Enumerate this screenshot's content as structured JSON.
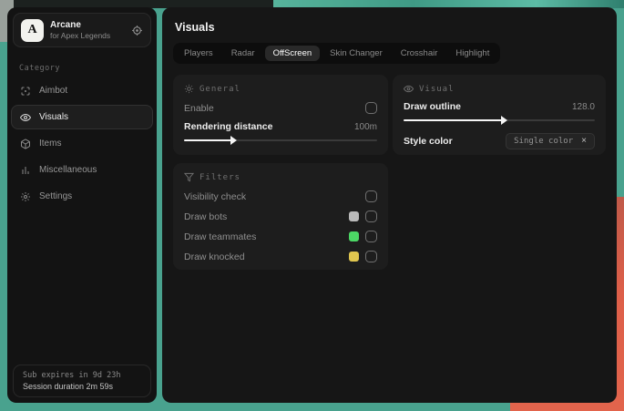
{
  "colors": {
    "backdrop_teal": "#49a28e",
    "backdrop_orange": "#dd5f49",
    "swatch_bots": "#bababa",
    "swatch_teammates": "#4cd765",
    "swatch_knocked": "#e0c64f"
  },
  "sidebar": {
    "app": {
      "initial": "A",
      "title": "Arcane",
      "subtitle": "for Apex Legends"
    },
    "category_label": "Category",
    "items": [
      {
        "label": "Aimbot",
        "icon": "crosshair-icon",
        "selected": false
      },
      {
        "label": "Visuals",
        "icon": "eye-icon",
        "selected": true
      },
      {
        "label": "Items",
        "icon": "box-icon",
        "selected": false
      },
      {
        "label": "Miscellaneous",
        "icon": "bars-icon",
        "selected": false
      },
      {
        "label": "Settings",
        "icon": "gear-icon",
        "selected": false
      }
    ],
    "status": {
      "line1": "Sub expires in 9d 23h",
      "line2": "Session duration 2m 59s"
    }
  },
  "main": {
    "title": "Visuals",
    "tabs": [
      {
        "label": "Players",
        "selected": false
      },
      {
        "label": "Radar",
        "selected": false
      },
      {
        "label": "OffScreen",
        "selected": true
      },
      {
        "label": "Skin Changer",
        "selected": false
      },
      {
        "label": "Crosshair",
        "selected": false
      },
      {
        "label": "Highlight",
        "selected": false
      }
    ],
    "general": {
      "header": "General",
      "enable_label": "Enable",
      "enable_checked": false,
      "rendering_label": "Rendering distance",
      "rendering_value": "100m",
      "slider_fill": "25%"
    },
    "filters": {
      "header": "Filters",
      "rows": [
        {
          "label": "Visibility check",
          "checked": false
        },
        {
          "label": "Draw bots",
          "swatch": "#bababa",
          "checked": false
        },
        {
          "label": "Draw teammates",
          "swatch": "#4cd765",
          "checked": false
        },
        {
          "label": "Draw knocked",
          "swatch": "#e0c64f",
          "checked": false
        }
      ]
    },
    "visual": {
      "header": "Visual",
      "outline_label": "Draw outline",
      "outline_value": "128.0",
      "slider_fill": "52%",
      "style_label": "Style color",
      "style_value": "Single color",
      "clear_label": "×"
    }
  }
}
